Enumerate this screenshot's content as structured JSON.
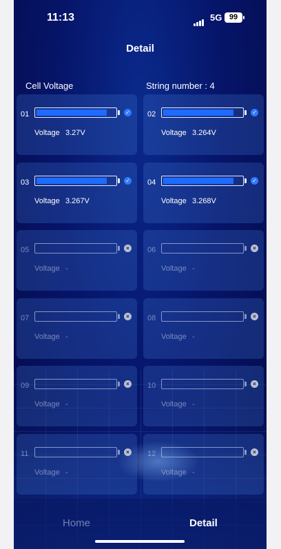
{
  "status_bar": {
    "time": "11:13",
    "network": "5G",
    "battery": "99"
  },
  "header": {
    "title": "Detail"
  },
  "section": {
    "label": "Cell Voltage",
    "string_number": "String number : 4"
  },
  "voltage_label": "Voltage",
  "cells": [
    {
      "num": "01",
      "voltage": "3.27V",
      "active": true,
      "level": 0.9
    },
    {
      "num": "02",
      "voltage": "3.264V",
      "active": true,
      "level": 0.9
    },
    {
      "num": "03",
      "voltage": "3.267V",
      "active": true,
      "level": 0.9
    },
    {
      "num": "04",
      "voltage": "3.268V",
      "active": true,
      "level": 0.9
    },
    {
      "num": "05",
      "voltage": "-",
      "active": false,
      "level": 0
    },
    {
      "num": "06",
      "voltage": "-",
      "active": false,
      "level": 0
    },
    {
      "num": "07",
      "voltage": "-",
      "active": false,
      "level": 0
    },
    {
      "num": "08",
      "voltage": "-",
      "active": false,
      "level": 0
    },
    {
      "num": "09",
      "voltage": "-",
      "active": false,
      "level": 0
    },
    {
      "num": "10",
      "voltage": "-",
      "active": false,
      "level": 0
    },
    {
      "num": "11",
      "voltage": "-",
      "active": false,
      "level": 0
    },
    {
      "num": "12",
      "voltage": "-",
      "active": false,
      "level": 0
    }
  ],
  "tabs": [
    {
      "label": "Home",
      "active": false
    },
    {
      "label": "Detail",
      "active": true
    }
  ]
}
